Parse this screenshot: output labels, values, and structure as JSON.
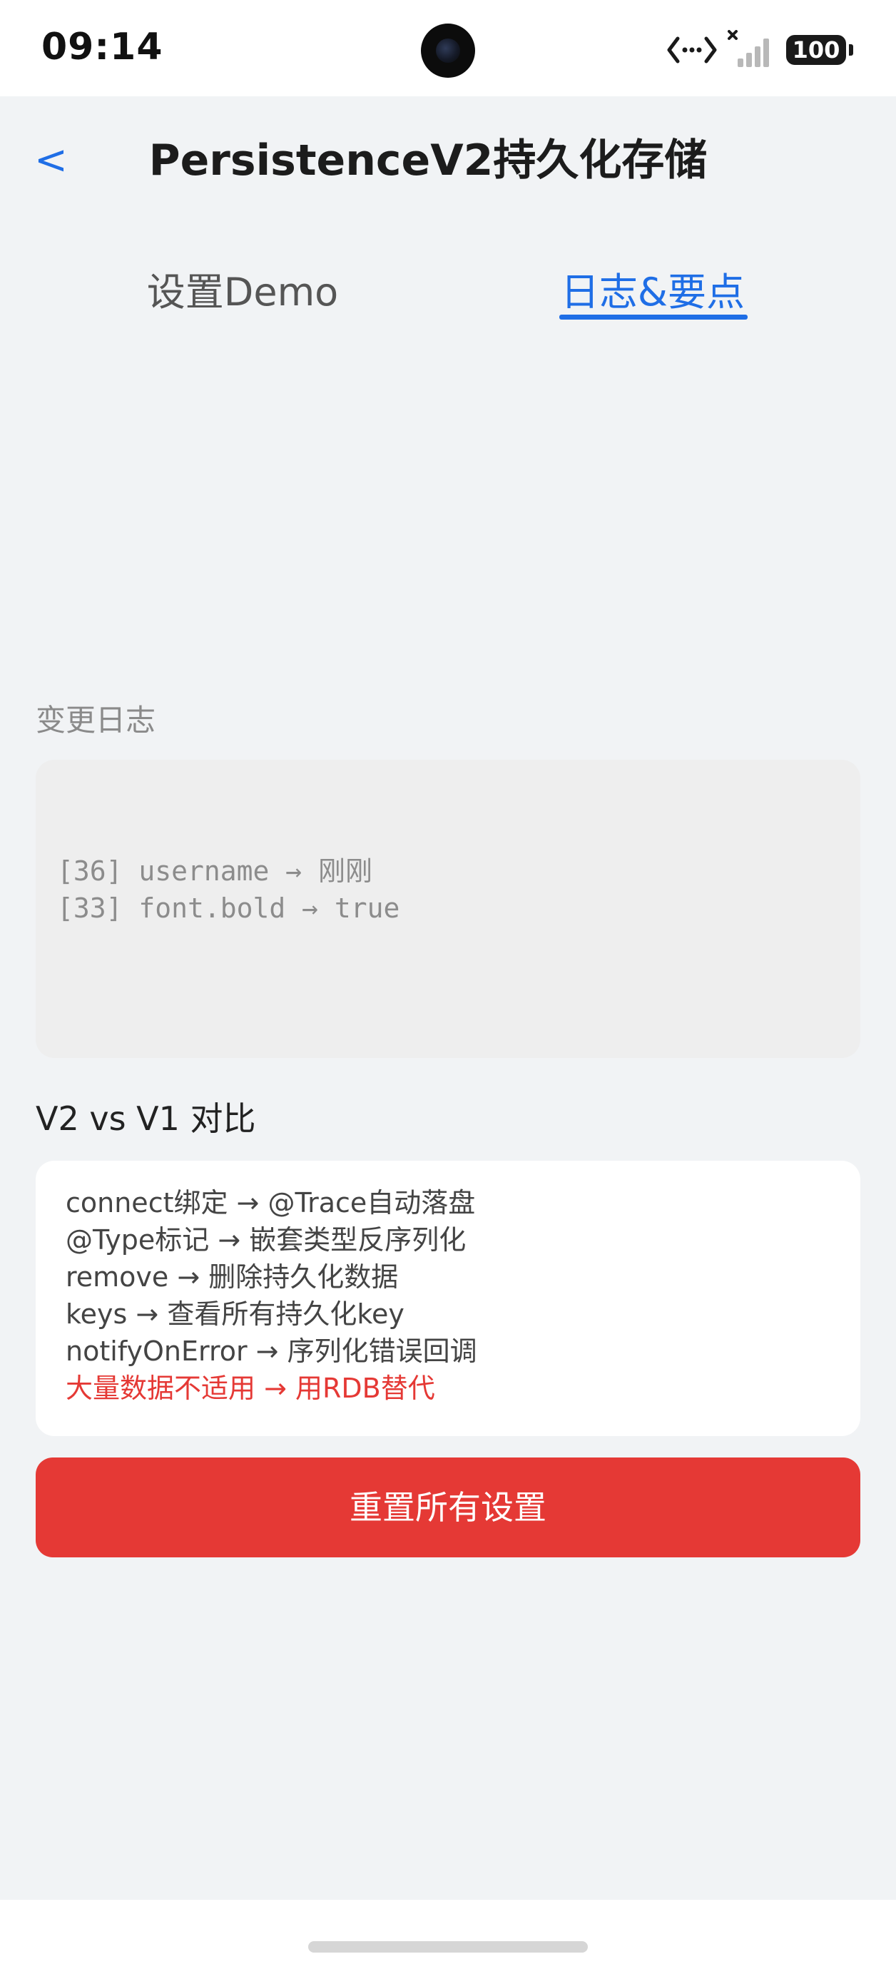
{
  "status_bar": {
    "time": "09:14",
    "battery": "100",
    "icons": [
      "camera-icon",
      "network-icon",
      "signal-icon",
      "battery-icon"
    ]
  },
  "header": {
    "back_label": "<",
    "title": "PersistenceV2持久化存储"
  },
  "tabs": [
    {
      "label": "设置Demo",
      "selected": false
    },
    {
      "label": "日志&要点",
      "selected": true
    }
  ],
  "log_section": {
    "label": "变更日志",
    "entries": [
      "[36] username → 刚刚",
      "[33] font.bold → true"
    ]
  },
  "comparison": {
    "title": "V2 vs V1 对比",
    "lines": [
      "connect绑定 → @Trace自动落盘",
      "@Type标记 → 嵌套类型反序列化",
      "remove → 删除持久化数据",
      "keys → 查看所有持久化key",
      "notifyOnError → 序列化错误回调"
    ],
    "warning": "大量数据不适用 → 用RDB替代"
  },
  "actions": {
    "reset_label": "重置所有设置"
  },
  "colors": {
    "accent": "#1f6ee6",
    "danger": "#e53935",
    "background": "#f1f3f5"
  }
}
